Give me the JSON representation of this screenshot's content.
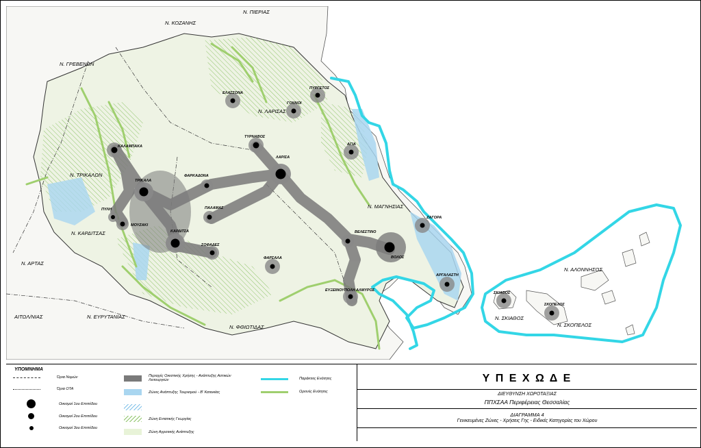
{
  "regions": {
    "kozani": "Ν. ΚΟΖΑΝΗΣ",
    "pieria": "Ν. ΠΙΕΡΙΑΣ",
    "grevena": "Ν. ΓΡΕΒΕΝΩΝ",
    "larisa": "Ν. ΛΑΡΙΣΑΣ",
    "trikala": "Ν. ΤΡΙΚΑΛΩΝ",
    "karditsa": "Ν. ΚΑΡΔΙΤΣΑΣ",
    "magnisia": "Ν. ΜΑΓΝΗΣΙΑΣ",
    "arta": "Ν. ΑΡΤΑΣ",
    "aitoloakarnania": "ΑΙΤΩΛ/ΝΙΑΣ",
    "evrytania": "Ν. ΕΥΡΥΤΑΝΙΑΣ",
    "fthiotida": "Ν. ΦΘΙΩΤΙΔΑΣ",
    "alonnisos": "Ν. ΑΛΟΝΝΗΣΟΣ",
    "skiathos": "Ν. ΣΚΙΑΘΟΣ",
    "skopelos": "Ν. ΣΚΟΠΕΛΟΣ"
  },
  "towns": {
    "elassona": "ΕΛΑΣΣΟΝΑ",
    "pyrgetos": "ΠΥΡΓΕΤΟΣ",
    "gonnoi": "ΓΟΝΝΟΙ",
    "kalampaka": "ΚΑΛΑΜΠΑΚΑ",
    "tyrnavos": "ΤΥΡΝΑΒΟΣ",
    "larisa": "ΛΑΡΙΣΑ",
    "agia": "ΑΓΙΑ",
    "trikala": "ΤΡΙΚΑΛΑ",
    "farkadona": "ΦΑΡΚΑΔΟΝΑ",
    "palamas": "ΠΑΛΑΜΑΣ",
    "pyli": "ΠΥΛΗ",
    "mouzaki": "ΜΟΥΖΑΚΙ",
    "karditsa": "ΚΑΡΔΙΤΣΑ",
    "sofades": "ΣΟΦΑΔΕΣ",
    "velestino": "ΒΕΛΕΣΤΙΝΟ",
    "zagora": "ΖΑΓΟΡΑ",
    "volos": "ΒΟΛΟΣ",
    "farsala": "ΦΑΡΣΑΛΑ",
    "argalasti": "ΑΡΓΑΛΑΣΤΗ",
    "almyros": "ΕΥΞΕΙΝΟΥΠΟΛΗ ΑΛΜΥΡΟΣ",
    "skiathos": "ΣΚΙΑΘΟΣ",
    "skopelos": "ΣΚΟΠΕΛΟΣ"
  },
  "legend": {
    "heading": "ΥΠΟΜΝΗΜΑ",
    "nomos_border": "Όρια Νομών",
    "ota_border": "Όρια ΟΤΑ",
    "level1": "Οικισμοί 1ου Επιπέδου",
    "level2": "Οικισμοί 2ου Επιπέδου",
    "level3": "Οικισμοί 3ου Επιπέδου",
    "urban_zone": "Περιοχές Οικιστικής Χρήσης - Ανάπτυξης Αστικών Λειτουργιών",
    "tourism_zone": "Ζώνες Ανάπτυξης Τουρισμού - Β' Κατοικίας",
    "intensive_agri": "Ζώνη Εντατικής Γεωργίας",
    "agri_dev": "Ζώνη Αγροτικής Ανάπτυξης",
    "coastal": "Παράκτιες Ενότητες",
    "mountain": "Ορεινές Ενότητες"
  },
  "title_block": {
    "agency": "Υ Π Ε Χ Ω Δ Ε",
    "directorate": "ΔΙΕΥΘΥΝΣΗ ΧΩΡΟΤΑΞΙΑΣ",
    "plan": "ΠΠΧΣΑΑ Περιφέρειας Θεσσαλίας",
    "diagram": "ΔΙΑΓΡΑΜΜΑ 4",
    "subtitle": "Γενικευμένες Ζώνες - Χρήσεις Γης - Ειδικές Κατηγορίες του Χώρου"
  },
  "colors": {
    "sea": "#ffffff",
    "land": "#f2f3ee",
    "urban": "#7a7a7a",
    "coastal": "#33d6e6",
    "mountain": "#9fcf6e",
    "tourism": "#a9d6f0",
    "agri": "#e8f3d8"
  }
}
